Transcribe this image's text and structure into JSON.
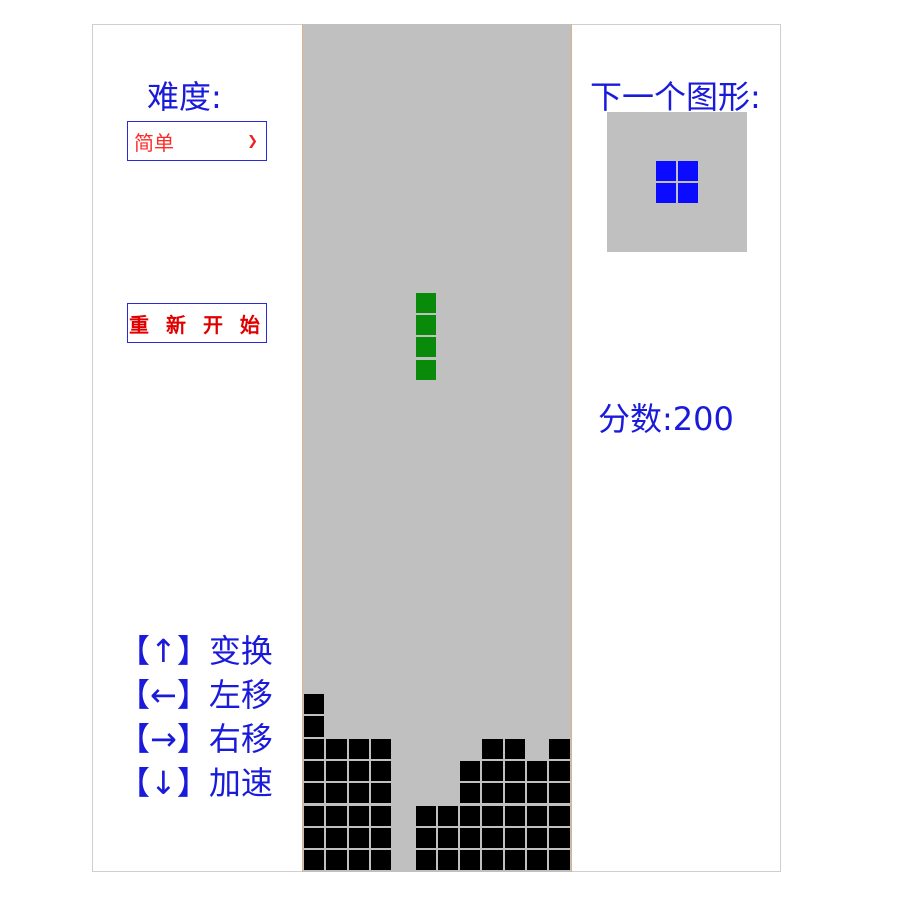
{
  "sidebar": {
    "difficulty_label": "难度:",
    "difficulty_value": "简单",
    "restart_label": "重 新 开 始",
    "controls": [
      {
        "label": "【↑】变换"
      },
      {
        "label": "【←】左移"
      },
      {
        "label": "【→】右移"
      },
      {
        "label": "【↓】加速"
      }
    ]
  },
  "next_piece": {
    "label": "下一个图形:",
    "shape": "O",
    "color": "#0b0bff",
    "cells": [
      [
        0,
        0
      ],
      [
        1,
        0
      ],
      [
        0,
        1
      ],
      [
        1,
        1
      ]
    ]
  },
  "score": {
    "label": "分数:",
    "value": "200"
  },
  "board": {
    "columns": 12,
    "rows": 38,
    "empty_color": "#c0c0c0",
    "locked_color": "#000000",
    "active_piece": {
      "shape": "I",
      "color": "#0a8a0a",
      "cells": [
        [
          5,
          12
        ],
        [
          5,
          13
        ],
        [
          5,
          14
        ],
        [
          5,
          15
        ]
      ]
    },
    "locked_cells": [
      [
        0,
        30
      ],
      [
        0,
        31
      ],
      [
        0,
        32
      ],
      [
        1,
        32
      ],
      [
        2,
        32
      ],
      [
        3,
        32
      ],
      [
        8,
        32
      ],
      [
        9,
        32
      ],
      [
        11,
        32
      ],
      [
        0,
        33
      ],
      [
        1,
        33
      ],
      [
        2,
        33
      ],
      [
        3,
        33
      ],
      [
        7,
        33
      ],
      [
        8,
        33
      ],
      [
        9,
        33
      ],
      [
        10,
        33
      ],
      [
        11,
        33
      ],
      [
        0,
        34
      ],
      [
        1,
        34
      ],
      [
        2,
        34
      ],
      [
        3,
        34
      ],
      [
        7,
        34
      ],
      [
        8,
        34
      ],
      [
        9,
        34
      ],
      [
        10,
        34
      ],
      [
        11,
        34
      ],
      [
        0,
        35
      ],
      [
        1,
        35
      ],
      [
        2,
        35
      ],
      [
        3,
        35
      ],
      [
        5,
        35
      ],
      [
        6,
        35
      ],
      [
        7,
        35
      ],
      [
        8,
        35
      ],
      [
        9,
        35
      ],
      [
        10,
        35
      ],
      [
        11,
        35
      ],
      [
        0,
        36
      ],
      [
        1,
        36
      ],
      [
        2,
        36
      ],
      [
        3,
        36
      ],
      [
        5,
        36
      ],
      [
        6,
        36
      ],
      [
        7,
        36
      ],
      [
        8,
        36
      ],
      [
        9,
        36
      ],
      [
        10,
        36
      ],
      [
        11,
        36
      ],
      [
        0,
        37
      ],
      [
        1,
        37
      ],
      [
        2,
        37
      ],
      [
        3,
        37
      ],
      [
        5,
        37
      ],
      [
        6,
        37
      ],
      [
        7,
        37
      ],
      [
        8,
        37
      ],
      [
        9,
        37
      ],
      [
        10,
        37
      ],
      [
        11,
        37
      ]
    ]
  }
}
